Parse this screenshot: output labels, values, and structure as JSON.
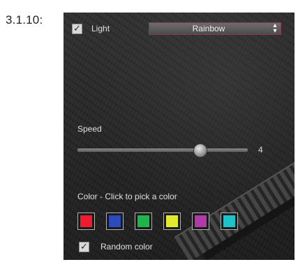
{
  "step": {
    "label": "3.1.10:"
  },
  "light": {
    "label": "Light",
    "checked": true,
    "check_glyph": "✓"
  },
  "effect": {
    "value": "Rainbow",
    "arrow_icon": "up-down-arrows-icon"
  },
  "speed": {
    "label": "Speed",
    "value": "4",
    "fraction": 0.72
  },
  "color": {
    "label": "Color  -  Click to pick a color",
    "swatches": [
      {
        "name": "red",
        "hex": "#ee1c2e"
      },
      {
        "name": "blue",
        "hex": "#2b4bbd"
      },
      {
        "name": "green",
        "hex": "#1eb64a"
      },
      {
        "name": "yellow",
        "hex": "#e3e831"
      },
      {
        "name": "purple",
        "hex": "#b13aa8"
      },
      {
        "name": "cyan",
        "hex": "#1fc2c9"
      }
    ]
  },
  "random_color": {
    "label": "Random color",
    "checked": true,
    "check_glyph": "✓"
  }
}
